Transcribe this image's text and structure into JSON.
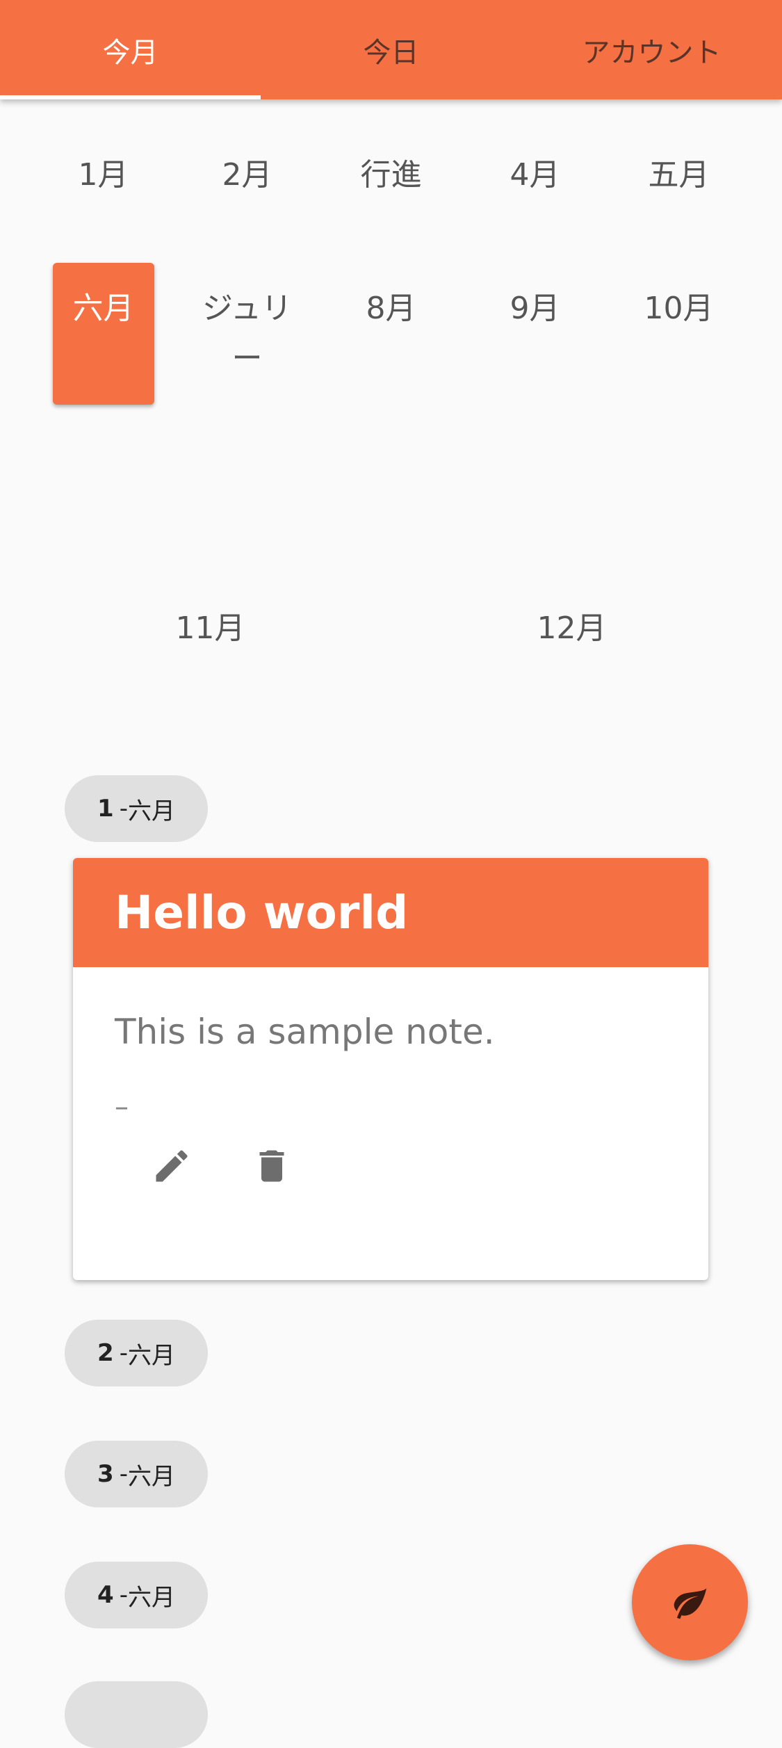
{
  "tabs": [
    {
      "label": "今月",
      "active": true
    },
    {
      "label": "今日",
      "active": false
    },
    {
      "label": "アカウント",
      "active": false
    }
  ],
  "months_row1": [
    "1月",
    "2月",
    "行進",
    "4月",
    "五月"
  ],
  "months_row2": [
    "六月",
    "ジュリー",
    "8月",
    "9月",
    "10月"
  ],
  "months_row3": [
    "11月",
    "12月"
  ],
  "selected_month": "六月",
  "chips": [
    {
      "num": "1",
      "month": "六月"
    },
    {
      "num": "2",
      "month": "六月"
    },
    {
      "num": "3",
      "month": "六月"
    },
    {
      "num": "4",
      "month": "六月"
    }
  ],
  "note": {
    "title": "Hello world",
    "body": "This is a sample note.",
    "dash": "–"
  },
  "icons": {
    "edit": "pencil-icon",
    "delete": "trash-icon",
    "fab": "leaf-icon"
  },
  "colors": {
    "accent": "#f57043",
    "chip": "#e0e0e0"
  }
}
